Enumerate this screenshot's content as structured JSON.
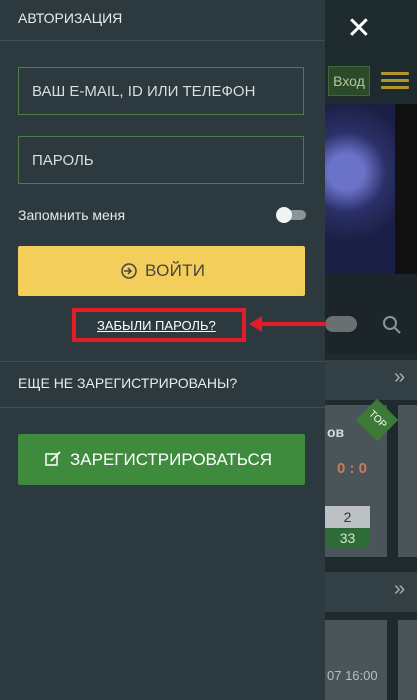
{
  "drawer": {
    "title": "АВТОРИЗАЦИЯ",
    "email_placeholder": "ВАШ E-MAIL, ID ИЛИ ТЕЛЕФОН",
    "password_placeholder": "ПАРОЛЬ",
    "remember_label": "Запомнить меня",
    "login_label": "ВОЙТИ",
    "forgot_label": "ЗАБЫЛИ ПАРОЛЬ?",
    "not_registered": "ЕЩЕ НЕ ЗАРЕГИСТРИРОВАНЫ?",
    "register_label": "ЗАРЕГИСТРИРОВАТЬСЯ"
  },
  "background": {
    "login_button": "Вход",
    "team_fragment": "ов",
    "score": "0 : 0",
    "odds_label": "2",
    "odds_value": "33",
    "top_badge": "TOP",
    "time": "07 16:00"
  },
  "colors": {
    "login_button": "#f4ce5a",
    "register_button": "#3f8b3d",
    "highlight": "#e41c2a",
    "drawer_bg": "#2c393f"
  },
  "icons": {
    "close": "close-icon",
    "login": "login-icon",
    "register": "edit-icon",
    "search": "search-icon",
    "menu": "menu-icon"
  }
}
